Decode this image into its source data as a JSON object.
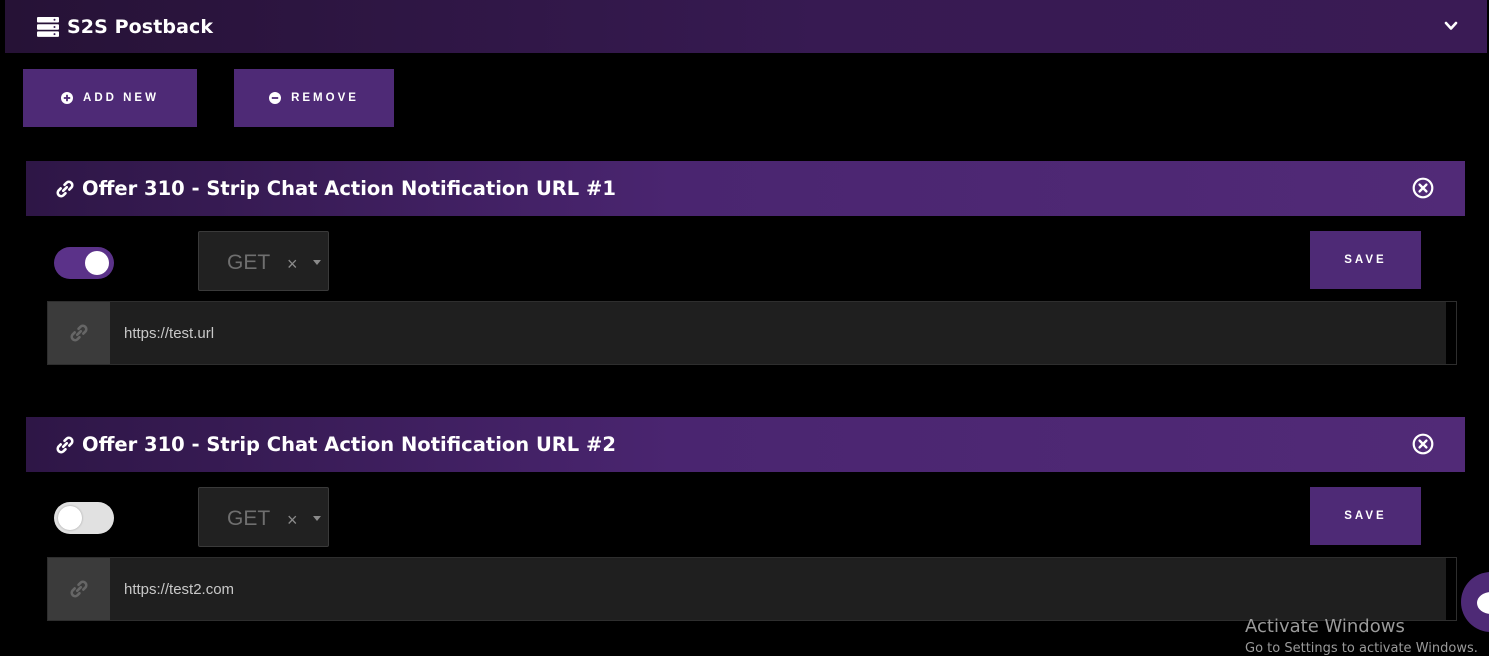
{
  "header": {
    "title": "S2S Postback",
    "icon": "server-icon",
    "collapse_icon": "chevron-down-icon"
  },
  "toolbar": {
    "add_label": "ADD NEW",
    "remove_label": "REMOVE"
  },
  "postbacks": [
    {
      "title": "Offer 310 - Strip Chat Action Notification URL #1",
      "enabled": true,
      "method": "GET",
      "url": "https://test.url",
      "save_label": "SAVE"
    },
    {
      "title": "Offer 310 - Strip Chat Action Notification URL #2",
      "enabled": false,
      "method": "GET",
      "url": "https://test2.com",
      "save_label": "SAVE"
    }
  ],
  "select_clear_glyph": "×",
  "watermark": {
    "line1": "Activate Windows",
    "line2": "Go to Settings to activate Windows."
  },
  "colors": {
    "accent": "#4e2a76",
    "toggle_on": "#5b3289",
    "toggle_off": "#e1e1e1",
    "background": "#000000"
  }
}
